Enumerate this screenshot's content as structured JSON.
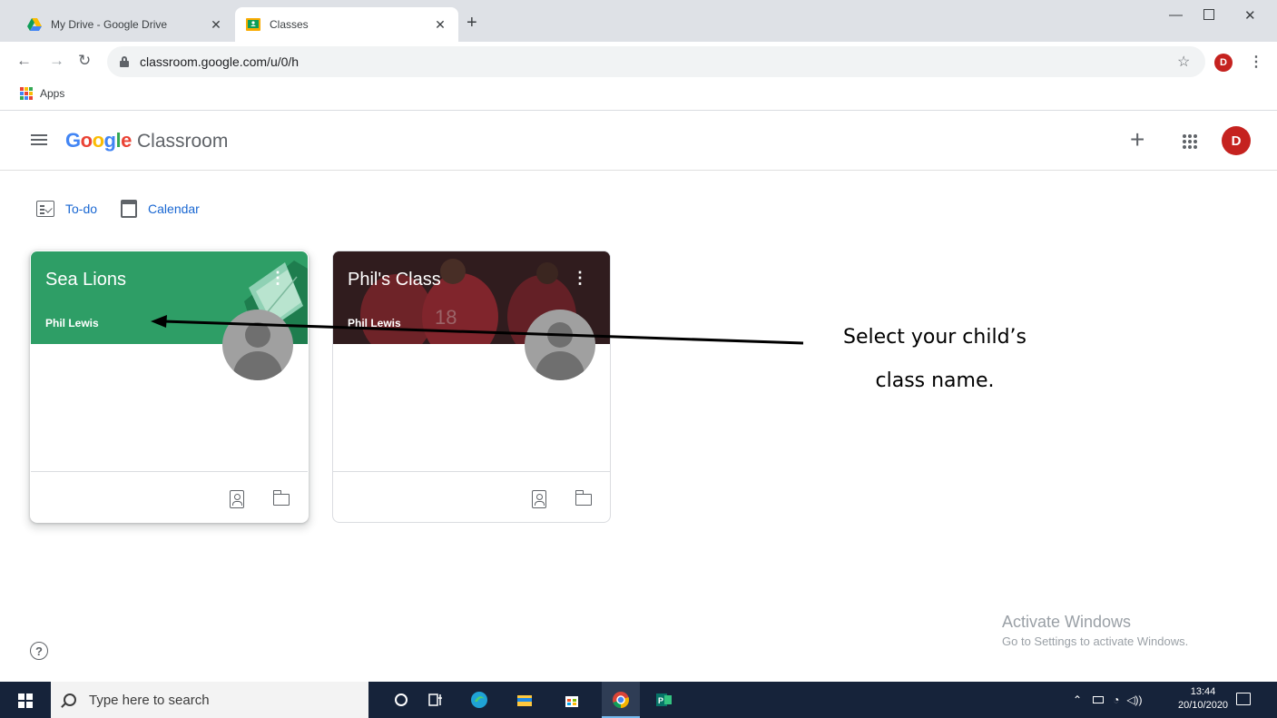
{
  "browser": {
    "tabs": [
      {
        "title": "My Drive - Google Drive",
        "active": false
      },
      {
        "title": "Classes",
        "active": true
      }
    ],
    "new_tab": "+",
    "address": "classroom.google.com/u/0/h",
    "profile_initial": "D",
    "bookmarks": {
      "apps_label": "Apps"
    }
  },
  "classroom": {
    "brand_google": "Google",
    "brand_product": "Classroom",
    "account_initial": "D",
    "quick_links": {
      "todo": "To-do",
      "calendar": "Calendar"
    },
    "classes": [
      {
        "name": "Sea Lions",
        "teacher": "Phil Lewis",
        "banner_color": "#2e9e66"
      },
      {
        "name": "Phil's Class",
        "teacher": "Phil Lewis",
        "banner_color": "#4a2a2c"
      }
    ],
    "help": "?"
  },
  "annotation": {
    "line1": "Select your child’s",
    "line2": "class name."
  },
  "watermark": {
    "title": "Activate Windows",
    "subtitle": "Go to Settings to activate Windows."
  },
  "taskbar": {
    "search_placeholder": "Type here to search",
    "time": "13:44",
    "date": "20/10/2020"
  }
}
